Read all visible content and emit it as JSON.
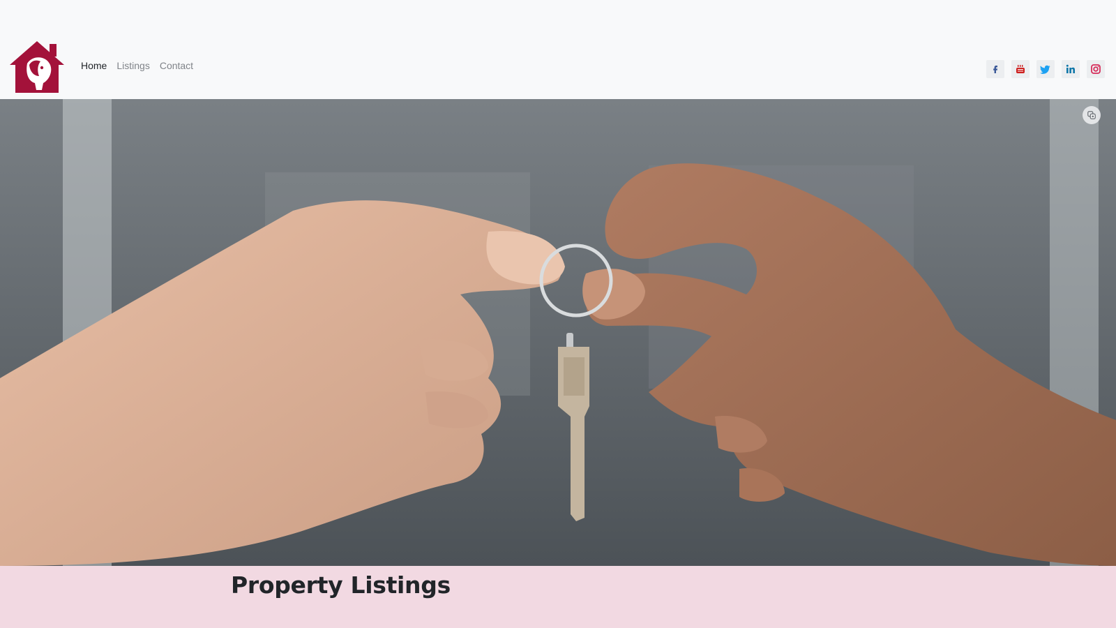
{
  "nav": {
    "logo_alt": "Goat house logo",
    "items": [
      {
        "label": "Home",
        "active": true
      },
      {
        "label": "Listings",
        "active": false
      },
      {
        "label": "Contact",
        "active": false
      }
    ]
  },
  "social": [
    {
      "icon": "facebook-icon",
      "color": "#3b5998"
    },
    {
      "icon": "youtube-icon",
      "color": "#cd201f"
    },
    {
      "icon": "twitter-icon",
      "color": "#1da1f2"
    },
    {
      "icon": "linkedin-icon",
      "color": "#0e76a8"
    },
    {
      "icon": "instagram-icon",
      "color": "#c13584"
    }
  ],
  "hero": {
    "image": "hands-passing-house-key",
    "badge_icon": "copy-icon"
  },
  "section": {
    "title": "Property Listings"
  },
  "colors": {
    "brand": "#a3123a",
    "band": "#f2d9e2"
  }
}
